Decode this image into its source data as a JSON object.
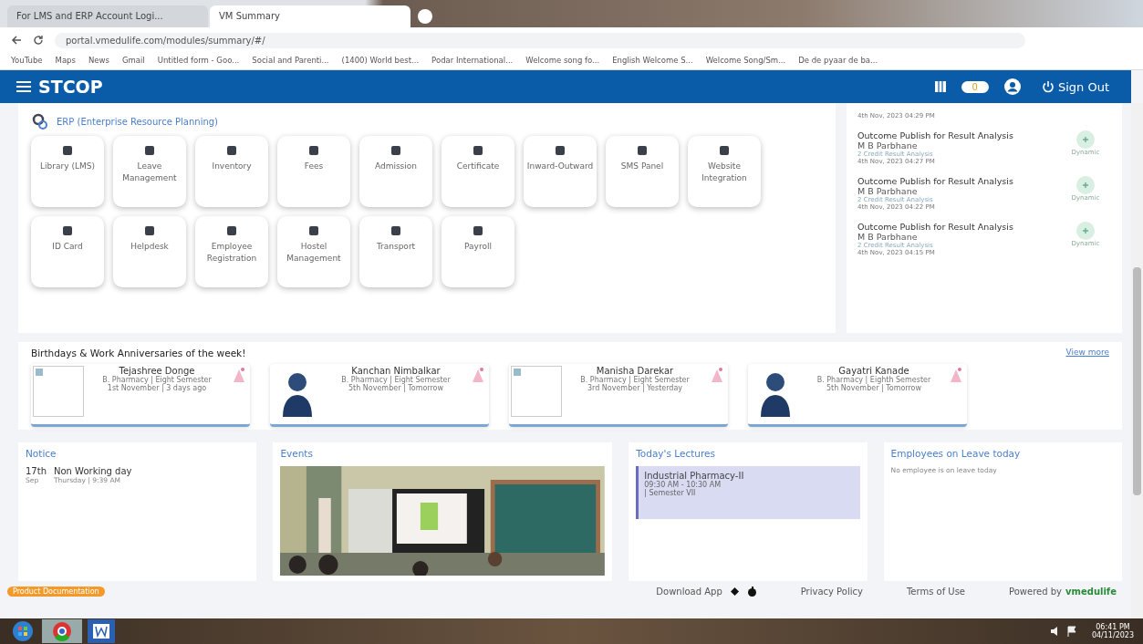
{
  "browser": {
    "tabs": [
      {
        "title": "For LMS and ERP Account Logi...",
        "selected": false
      },
      {
        "title": "VM Summary",
        "selected": true
      }
    ],
    "url": "portal.vmedulife.com/modules/summary/#/",
    "bookmarks": [
      "YouTube",
      "Maps",
      "News",
      "Gmail",
      "Untitled form - Goo...",
      "Social and Parenti...",
      "(1400) World best...",
      "Podar International...",
      "Welcome song fo...",
      "English Welcome S...",
      "Welcome Song/Sm...",
      "De de pyaar de ba..."
    ]
  },
  "header": {
    "brand": "STCOP",
    "badge": "0",
    "sign_out": "Sign Out"
  },
  "erp": {
    "title": "ERP (Enterprise Resource Planning)",
    "modules": [
      {
        "label": "Library (LMS)"
      },
      {
        "label": "Leave Management"
      },
      {
        "label": "Inventory"
      },
      {
        "label": "Fees"
      },
      {
        "label": "Admission"
      },
      {
        "label": "Certificate"
      },
      {
        "label": "Inward-Outward"
      },
      {
        "label": "SMS Panel"
      },
      {
        "label": "Website Integration"
      },
      {
        "label": "ID Card"
      },
      {
        "label": "Helpdesk"
      },
      {
        "label": "Employee Registration"
      },
      {
        "label": "Hostel Management"
      },
      {
        "label": "Transport"
      },
      {
        "label": "Payroll"
      }
    ]
  },
  "activity": {
    "first_time": "4th Nov, 2023 04:29 PM",
    "items": [
      {
        "title": "Outcome Publish for Result Analysis",
        "name": "M B Parbhane",
        "detail": "2 Credit Result Analysis",
        "time": "4th Nov, 2023 04:27 PM",
        "tag": "Dynamic"
      },
      {
        "title": "Outcome Publish for Result Analysis",
        "name": "M B Parbhane",
        "detail": "2 Credit Result Analysis",
        "time": "4th Nov, 2023 04:22 PM",
        "tag": "Dynamic"
      },
      {
        "title": "Outcome Publish for Result Analysis",
        "name": "M B Parbhane",
        "detail": "2 Credit Result Analysis",
        "time": "4th Nov, 2023 04:15 PM",
        "tag": "Dynamic"
      }
    ]
  },
  "birthdays": {
    "title": "Birthdays & Work Anniversaries of the week!",
    "view_more": "View more",
    "people": [
      {
        "name": "Tejashree Donge",
        "course": "B. Pharmacy | Eight Semester",
        "when": "1st November | 3 days ago",
        "photo_broken": true
      },
      {
        "name": "Kanchan Nimbalkar",
        "course": "B. Pharmacy | Eight Semester",
        "when": "5th November | Tomorrow",
        "photo_broken": false
      },
      {
        "name": "Manisha Darekar",
        "course": "B. Pharmacy | Eight Semester",
        "when": "3rd November | Yesterday",
        "photo_broken": true
      },
      {
        "name": "Gayatri Kanade",
        "course": "B. Pharmacy | Eighth Semester",
        "when": "5th November | Tomorrow",
        "photo_broken": false
      }
    ]
  },
  "notice": {
    "title": "Notice",
    "items": [
      {
        "day": "17th",
        "month": "Sep",
        "title": "Non Working day",
        "meta": "Thursday | 9:39 AM"
      }
    ]
  },
  "events": {
    "title": "Events",
    "kind": "picture"
  },
  "lectures": {
    "title": "Today's Lectures",
    "items": [
      {
        "subject": "Industrial Pharmacy-II",
        "time": "09:30 AM - 10:30 AM",
        "semester": "| Semester VII"
      }
    ]
  },
  "leave": {
    "title": "Employees on Leave today",
    "message": "No employee is on leave today"
  },
  "footer": {
    "doc": "Product Documentation",
    "download": "Download App",
    "privacy": "Privacy Policy",
    "terms": "Terms of Use",
    "powered": "Powered by",
    "brand": "vmedulife"
  },
  "taskbar": {
    "time": "06:41 PM",
    "date": "04/11/2023"
  }
}
